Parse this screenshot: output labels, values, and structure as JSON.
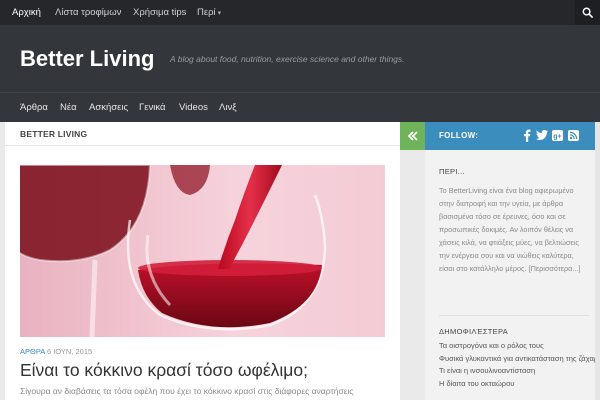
{
  "topnav": {
    "items": [
      {
        "label": "Αρχική",
        "active": true
      },
      {
        "label": "Λίστα τροφίμων",
        "active": false
      },
      {
        "label": "Χρήσιμα tips",
        "active": false
      },
      {
        "label": "Περί",
        "active": false,
        "dropdown": true
      }
    ],
    "caret": "▾",
    "search_icon": "search-icon"
  },
  "header": {
    "title": "Better Living",
    "tagline": "A blog about food, nutrition, exercise science and other things."
  },
  "mainnav": {
    "items": [
      "Άρθρα",
      "Νέα",
      "Ασκήσεις",
      "Γενικά",
      "Videos",
      "Λινξ"
    ]
  },
  "content": {
    "breadcrumb": "BETTER LIVING",
    "post": {
      "category": "ΑΡΘΡΑ",
      "date": "6 ΙΟΥΝ, 2015",
      "title": "Είναι το κόκκινο κρασί τόσο ωφέλιμο;",
      "excerpt": "Σίγουρα αν διαβάσεις τα τόσα οφέλη που έχει το κόκκινο κρασί στις διάφορες αναρτήσεις"
    }
  },
  "sidebar": {
    "follow_label": "FOLLOW:",
    "social_icons": [
      "facebook-icon",
      "twitter-icon",
      "google-plus-icon",
      "rss-icon"
    ],
    "about": {
      "title": "ΠΕΡΙ...",
      "text": "Το BetterLiving είναι ένα blog αφιερωμένο στην διατροφή και την υγεία, με άρθρα βασισμένα τόσο σε έρευνες, όσο και σε προσωπικές δοκιμές. Αν λοιπόν θέλεις να χάσεις κιλά, να φτιάξεις μύες, να βελτιώσεις την ενέργεια σου και να νιώθεις καλύτερα, είσαι στο κατάλληλο μέρος. [Περισσότερα...]"
    },
    "popular": {
      "title": "ΔΗΜΟΦΙΛΈΣΤΕΡΑ",
      "items": [
        "Τα οιστρογόνα και ο ρόλος τους",
        "Φυσικά γλυκαντικά για αντικατάσταση της ζάχαρης",
        "Τι είναι η ινσουλινοαντίσταση",
        "Η δίαιτα του οκταώρου"
      ]
    }
  },
  "colors": {
    "topbar": "#26272b",
    "header": "#33363b",
    "accent_blue": "#3b8dbd",
    "accent_green": "#6fb35a"
  }
}
